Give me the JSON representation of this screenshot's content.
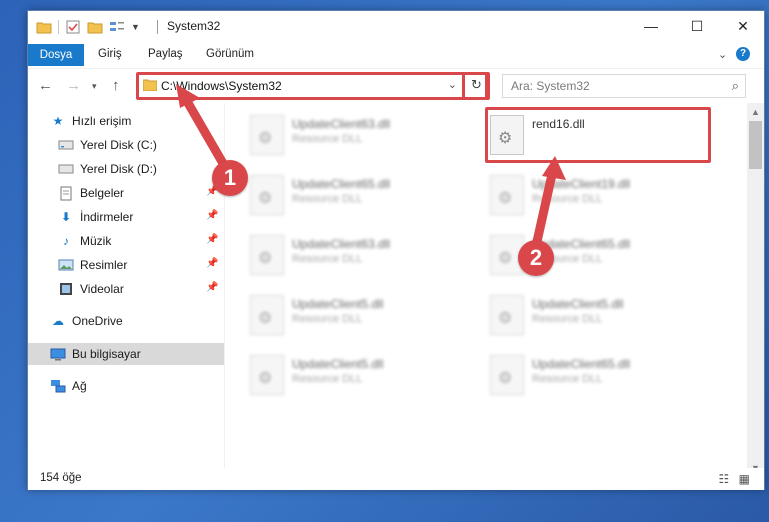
{
  "window": {
    "title": "System32"
  },
  "ribbon": {
    "tabs": [
      {
        "label": "Dosya",
        "active": true
      },
      {
        "label": "Giriş"
      },
      {
        "label": "Paylaş"
      },
      {
        "label": "Görünüm"
      }
    ]
  },
  "address": {
    "path": "C:\\Windows\\System32"
  },
  "search": {
    "placeholder": "Ara: System32"
  },
  "nav": {
    "items": [
      {
        "label": "Hızlı erişim",
        "icon": "star-icon"
      },
      {
        "label": "Yerel Disk (C:)",
        "icon": "drive-icon"
      },
      {
        "label": "Yerel Disk (D:)",
        "icon": "drive-icon"
      },
      {
        "label": "Belgeler",
        "icon": "documents-icon"
      },
      {
        "label": "İndirmeler",
        "icon": "download-icon"
      },
      {
        "label": "Müzik",
        "icon": "music-icon"
      },
      {
        "label": "Resimler",
        "icon": "pictures-icon"
      },
      {
        "label": "Videolar",
        "icon": "video-icon"
      },
      {
        "label": "OneDrive",
        "icon": "cloud-icon"
      },
      {
        "label": "Bu bilgisayar",
        "icon": "computer-icon"
      },
      {
        "label": "Ağ",
        "icon": "network-icon"
      }
    ]
  },
  "files": {
    "highlighted": {
      "name": "rend16.dll",
      "type": ""
    },
    "left_column": [
      {
        "name": "UpdateClient63.dll",
        "type": "Resource DLL"
      },
      {
        "name": "UpdateClient65.dll",
        "type": "Resource DLL"
      },
      {
        "name": "UpdateClient63.dll",
        "type": "Resource DLL"
      },
      {
        "name": "UpdateClient5.dll",
        "type": "Resource DLL"
      },
      {
        "name": "UpdateClient5.dll",
        "type": "Resource DLL"
      }
    ],
    "right_column": [
      {
        "name": "UpdateClient19.dll",
        "type": "Resource DLL"
      },
      {
        "name": "UpdateClient65.dll",
        "type": "Resource DLL"
      },
      {
        "name": "UpdateClient5.dll",
        "type": "Resource DLL"
      },
      {
        "name": "UpdateClient65.dll",
        "type": "Resource DLL"
      }
    ]
  },
  "status": {
    "count": "154 öğe"
  },
  "callouts": {
    "one": "1",
    "two": "2"
  },
  "colors": {
    "accent": "#1979ca",
    "callout": "#d9474a"
  }
}
